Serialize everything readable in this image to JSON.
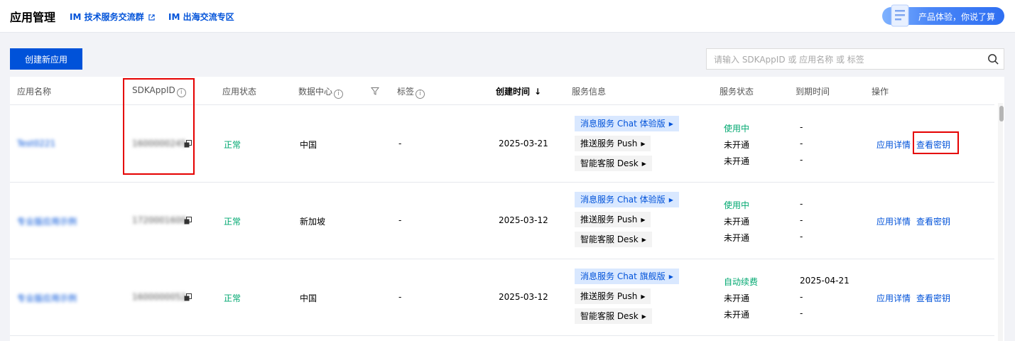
{
  "header": {
    "title": "应用管理",
    "links": [
      {
        "label": "IM 技术服务交流群",
        "external": true
      },
      {
        "label": "IM 出海交流专区",
        "external": false
      }
    ],
    "feedback_label": "产品体验，你说了算"
  },
  "toolbar": {
    "create_label": "创建新应用",
    "search_placeholder": "请输入 SDKAppID 或 应用名称 或 标签"
  },
  "table": {
    "columns": {
      "name": "应用名称",
      "sdkappid": "SDKAppID",
      "status": "应用状态",
      "datacenter": "数据中心",
      "tags": "标签",
      "created": "创建时间",
      "service_info": "服务信息",
      "service_status": "服务状态",
      "expire": "到期时间",
      "actions": "操作"
    },
    "sort": {
      "column": "created",
      "direction": "desc"
    },
    "rows": [
      {
        "name": "Test0221",
        "sdkappid": "1600000245",
        "status": "正常",
        "datacenter": "中国",
        "tags": "-",
        "created": "2025-03-21",
        "services": [
          {
            "label": "消息服务 Chat 体验版",
            "status": "使用中",
            "expire": "-"
          },
          {
            "label": "推送服务 Push",
            "status": "未开通",
            "expire": "-"
          },
          {
            "label": "智能客服 Desk",
            "status": "未开通",
            "expire": "-"
          }
        ],
        "actions": {
          "detail": "应用详情",
          "secret": "查看密钥"
        }
      },
      {
        "name": "专业版应用示例",
        "sdkappid": "1720001600",
        "status": "正常",
        "datacenter": "新加坡",
        "tags": "-",
        "created": "2025-03-12",
        "services": [
          {
            "label": "消息服务 Chat 体验版",
            "status": "使用中",
            "expire": "-"
          },
          {
            "label": "推送服务 Push",
            "status": "未开通",
            "expire": "-"
          },
          {
            "label": "智能客服 Desk",
            "status": "未开通",
            "expire": "-"
          }
        ],
        "actions": {
          "detail": "应用详情",
          "secret": "查看密钥"
        }
      },
      {
        "name": "专业版应用示例",
        "sdkappid": "1600000052",
        "status": "正常",
        "datacenter": "中国",
        "tags": "-",
        "created": "2025-03-12",
        "services": [
          {
            "label": "消息服务 Chat 旗舰版",
            "status": "自动续费",
            "expire": "2025-04-21"
          },
          {
            "label": "推送服务 Push",
            "status": "未开通",
            "expire": "-"
          },
          {
            "label": "智能客服 Desk",
            "status": "未开通",
            "expire": "-"
          }
        ],
        "actions": {
          "detail": "应用详情",
          "secret": "查看密钥"
        }
      }
    ]
  },
  "colors": {
    "brand": "#0052d9",
    "success": "#00a870",
    "highlight": "#e50000",
    "active_service_bg": "#d9e8ff"
  },
  "icons": [
    "external-link-icon",
    "document-icon",
    "search-icon",
    "info-icon",
    "filter-icon",
    "sort-down-icon",
    "copy-icon",
    "caret-right-icon"
  ]
}
